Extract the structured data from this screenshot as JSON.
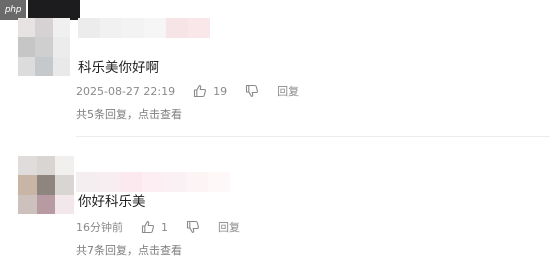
{
  "watermark": {
    "text": "php"
  },
  "comments": [
    {
      "text": "科乐美你好啊",
      "time": "2025-08-27 22:19",
      "likes": "19",
      "reply_label": "回复",
      "summary": "共5条回复，点击查看",
      "avatar_colors": [
        "#e7e3e3",
        "#d6d2d3",
        "#f1f0f0",
        "#c6c6c7",
        "#d0cfd0",
        "#ececec",
        "#dcdcdc",
        "#c5c9cc",
        "#e9e9e9"
      ],
      "name_colors": [
        "#ececec",
        "#f1f1f1",
        "#f3f3f3",
        "#f6f6f6",
        "#f7e4e6",
        "#fae7e9"
      ]
    },
    {
      "text": "你好科乐美",
      "time": "16分钟前",
      "likes": "1",
      "reply_label": "回复",
      "summary": "共7条回复，点击查看",
      "avatar_colors": [
        "#e0dcdb",
        "#d8d5d3",
        "#f2f0ef",
        "#c9b5a6",
        "#8e857f",
        "#d9d5d2",
        "#ccc1bd",
        "#b89aa3",
        "#f2e8ec"
      ],
      "name_colors": [
        "#f5eef1",
        "#f8eef2",
        "#fbe9ef",
        "#fdeef3",
        "#fbf0f4",
        "#fdf4f6",
        "#fef8f9"
      ]
    }
  ]
}
